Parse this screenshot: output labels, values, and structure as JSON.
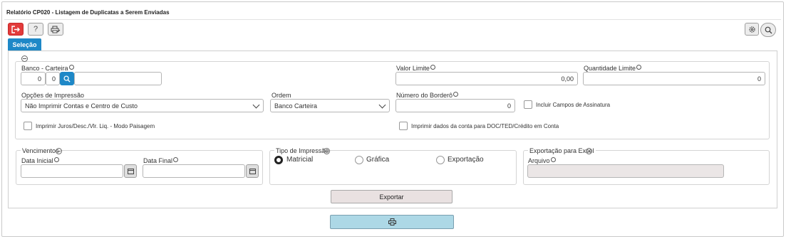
{
  "window": {
    "title": "Relatório CP020 - Listagem de Duplicatas a Serem Enviadas"
  },
  "toolbar": {
    "exit_icon": "exit-icon",
    "help_label": "?",
    "print_setup_icon": "printer-settings-icon",
    "settings_icon": "gear-icon",
    "search_icon": "search-icon"
  },
  "tabs": [
    {
      "label": "Seleção",
      "active": true
    }
  ],
  "selecao": {
    "banco_carteira": {
      "label": "Banco - Carteira",
      "banco": "0",
      "carteira": "0",
      "descricao": ""
    },
    "valor_limite": {
      "label": "Valor Limite",
      "value": "0,00"
    },
    "quantidade_limite": {
      "label": "Quantidade Limite",
      "value": "0"
    },
    "opcoes_impressao": {
      "label": "Opções de Impressão",
      "value": "Não Imprimir Contas e Centro de Custo"
    },
    "ordem": {
      "label": "Ordem",
      "value": "Banco Carteira"
    },
    "numero_bordero": {
      "label": "Número do Borderô",
      "value": "0"
    },
    "incluir_assinatura": {
      "label": "Incluir Campos de Assinatura",
      "checked": false
    },
    "imprimir_juros": {
      "label": "Imprimir Juros/Desc./Vlr. Liq. - Modo Paisagem",
      "checked": false
    },
    "imprimir_dados_conta": {
      "label": "Imprimir dados da conta para DOC/TED/Crédito em Conta",
      "checked": false
    }
  },
  "vencimentos": {
    "legend": "Vencimentos",
    "data_inicial": {
      "label": "Data Inicial",
      "value": ""
    },
    "data_final": {
      "label": "Data Final",
      "value": ""
    }
  },
  "tipo_impressao": {
    "legend": "Tipo de Impressão",
    "options": [
      {
        "label": "Matricial",
        "selected": true
      },
      {
        "label": "Gráfica",
        "selected": false
      },
      {
        "label": "Exportação",
        "selected": false
      }
    ]
  },
  "exportacao_excel": {
    "legend": "Exportação para Excel",
    "arquivo": {
      "label": "Arquivo",
      "value": ""
    }
  },
  "actions": {
    "exportar_label": "Exportar",
    "print_icon": "printer-icon"
  },
  "colors": {
    "accent": "#1e88c7",
    "exit": "#e23b3b",
    "print_button": "#add8e6"
  }
}
